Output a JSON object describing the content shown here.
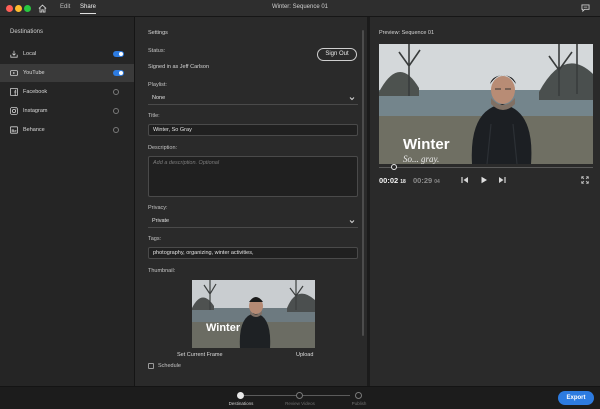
{
  "titlebar": {
    "tabs": [
      {
        "label": "Edit",
        "active": false
      },
      {
        "label": "Share",
        "active": true
      }
    ],
    "window_title": "Winter: Sequence 01",
    "traffic_colors": [
      "#ff5f57",
      "#febc2e",
      "#28c840"
    ]
  },
  "sidebar": {
    "title": "Destinations",
    "items": [
      {
        "label": "Local",
        "icon": "download-icon",
        "enabled": true,
        "selected": false
      },
      {
        "label": "YouTube",
        "icon": "youtube-icon",
        "enabled": true,
        "selected": true
      },
      {
        "label": "Facebook",
        "icon": "facebook-icon",
        "enabled": false,
        "selected": false
      },
      {
        "label": "Instagram",
        "icon": "instagram-icon",
        "enabled": false,
        "selected": false
      },
      {
        "label": "Behance",
        "icon": "behance-icon",
        "enabled": false,
        "selected": false
      }
    ]
  },
  "settings": {
    "title": "Settings",
    "status_label": "Status:",
    "status_value": "Signed in as Jeff Carlson",
    "sign_out": "Sign Out",
    "playlist_label": "Playlist:",
    "playlist_value": "None",
    "title_label": "Title:",
    "title_value": "Winter, So Gray",
    "description_label": "Description:",
    "description_placeholder": "Add a description. Optional",
    "privacy_label": "Privacy:",
    "privacy_value": "Private",
    "tags_label": "Tags:",
    "tags_value": "photography, organizing, winter activities,",
    "thumbnail_label": "Thumbnail:",
    "thumbnail_overlay": "Winter",
    "set_current_frame": "Set Current Frame",
    "upload": "Upload",
    "schedule": "Schedule"
  },
  "preview": {
    "title": "Preview: Sequence 01",
    "overlay_title": "Winter",
    "overlay_subtitle": "So... gray.",
    "current_time": "00:02",
    "current_frames": "18",
    "duration": "00:29",
    "duration_frames": "04",
    "playhead_fraction": 0.07
  },
  "footer": {
    "steps": [
      {
        "label": "Destinations",
        "active": true
      },
      {
        "label": "Review Videos",
        "active": false
      },
      {
        "label": "Publish",
        "active": false
      }
    ],
    "export": "Export"
  },
  "colors": {
    "accent": "#2d7be0",
    "background": "#1e1e1e",
    "panel": "#2a2a2a"
  }
}
